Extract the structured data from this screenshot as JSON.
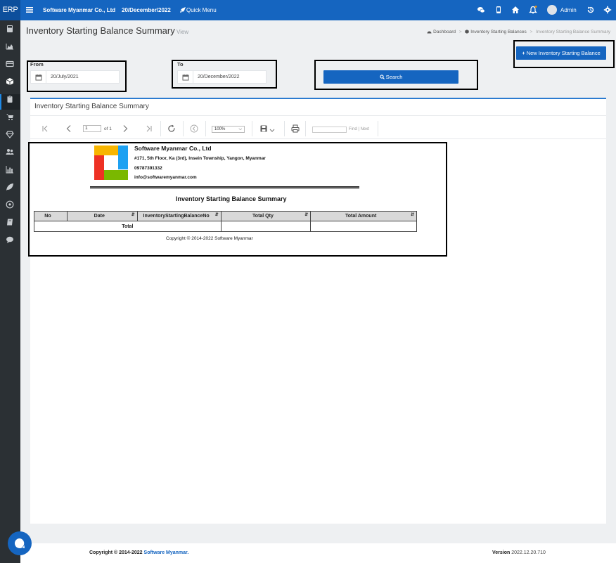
{
  "app": {
    "brand": "ERP",
    "company": "Software Myanmar Co., Ltd",
    "date": "20/December/2022",
    "quick_menu": "Quick Menu",
    "user": "Admin"
  },
  "page": {
    "title": "Inventory Starting Balance Summary",
    "subtitle": "View",
    "breadcrumbs": [
      "Dashboard",
      "Inventory Starting Balances",
      "Inventory Starting Balance Summary"
    ],
    "new_button": "New Inventory Starting Balance"
  },
  "filters": {
    "from_label": "From",
    "from_value": "20/July/2021",
    "to_label": "To",
    "to_value": "20/December/2022",
    "search_button": "Search"
  },
  "panel": {
    "title": "Inventory Starting Balance Summary"
  },
  "viewer": {
    "page_value": "1",
    "page_of": "of 1",
    "zoom": "100%",
    "find": "Find",
    "next": "Next"
  },
  "report": {
    "company": "Software Myanmar Co., Ltd",
    "address": "#171, 5th Floor, Ka (3rd), Insein Township, Yangon, Myanmar",
    "phone": "09787391332",
    "email": "info@softwaremyanmar.com",
    "title": "Inventory Starting Balance Summary",
    "columns": [
      "No",
      "Date",
      "InventoryStartingBalanceNo",
      "Total Qty",
      "Total Amount"
    ],
    "total_label": "Total",
    "copyright": "Copyright © 2014-2022 Software Myanmar"
  },
  "footer": {
    "copyright": "Copyright © 2014-2022 ",
    "link": "Software Myanmar.",
    "version_label": "Version",
    "version": "2022.12.20.710"
  },
  "colors": {
    "primary": "#1565c0",
    "sidebar": "#2b3034",
    "content_bg": "#eef0f2"
  },
  "icons": {
    "topbar": [
      "menu-icon",
      "rocket-icon",
      "wechat-icon",
      "mobile-icon",
      "home-icon",
      "bell-icon",
      "history-icon",
      "gear-icon"
    ],
    "sidebar": [
      "calculator-icon",
      "area-chart-icon",
      "credit-card-icon",
      "cube-icon",
      "clipboard-icon",
      "cart-icon",
      "diamond-icon",
      "users-icon",
      "bar-chart-icon",
      "leaf-icon",
      "soccer-icon",
      "book-icon",
      "comment-icon"
    ]
  }
}
